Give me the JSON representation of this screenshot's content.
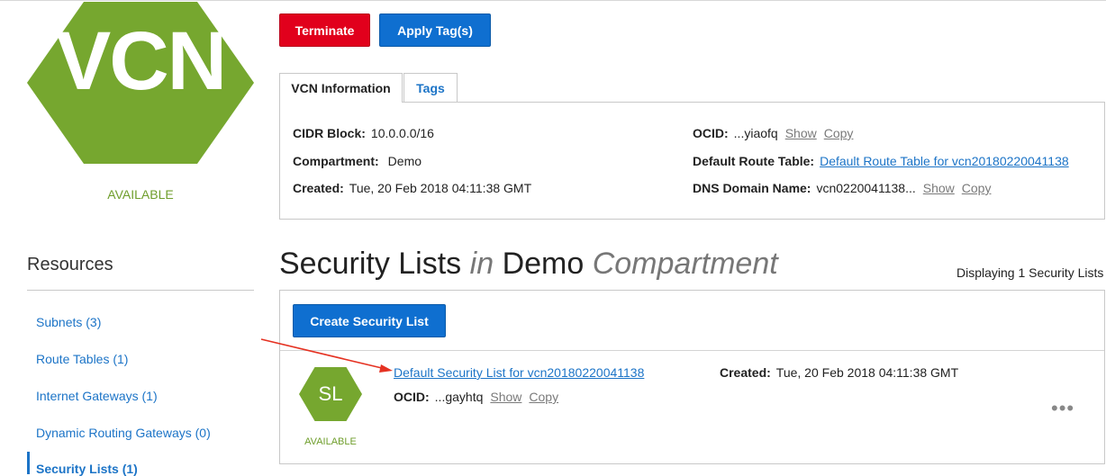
{
  "vcn": {
    "icon_text": "VCN",
    "status": "AVAILABLE",
    "brand_color": "#76a72f"
  },
  "actions": {
    "terminate": "Terminate",
    "apply_tags": "Apply Tag(s)"
  },
  "tabs": [
    {
      "label": "VCN Information",
      "active": true
    },
    {
      "label": "Tags",
      "active": false
    }
  ],
  "info": {
    "cidr_label": "CIDR Block:",
    "cidr_value": "10.0.0.0/16",
    "compartment_label": "Compartment:",
    "compartment_value": "Demo",
    "created_label": "Created:",
    "created_value": "Tue, 20 Feb 2018 04:11:38 GMT",
    "ocid_label": "OCID:",
    "ocid_value": "...yiaofq",
    "route_label": "Default Route Table:",
    "route_value": "Default Route Table for vcn20180220041138",
    "dns_label": "DNS Domain Name:",
    "dns_value": "vcn0220041138...",
    "show": "Show",
    "copy": "Copy"
  },
  "resources": {
    "title": "Resources",
    "items": [
      {
        "label": "Subnets (3)"
      },
      {
        "label": "Route Tables (1)"
      },
      {
        "label": "Internet Gateways (1)"
      },
      {
        "label": "Dynamic Routing Gateways (0)"
      },
      {
        "label": "Security Lists (1)"
      }
    ]
  },
  "section": {
    "title": "Security Lists",
    "in_word": "in",
    "compartment": "Demo",
    "compartment_word": "Compartment",
    "displaying": "Displaying 1 Security Lists",
    "create_button": "Create Security List"
  },
  "security_list": {
    "icon_text": "SL",
    "status": "AVAILABLE",
    "name": "Default Security List for vcn20180220041138",
    "ocid_label": "OCID:",
    "ocid_value": "...gayhtq",
    "created_label": "Created:",
    "created_value": "Tue, 20 Feb 2018 04:11:38 GMT",
    "more_icon": "ellipsis-icon"
  },
  "colors": {
    "primary": "#0f6fd0",
    "danger": "#e1001c",
    "link": "#1c74c7",
    "annotation_arrow": "#e53222"
  }
}
